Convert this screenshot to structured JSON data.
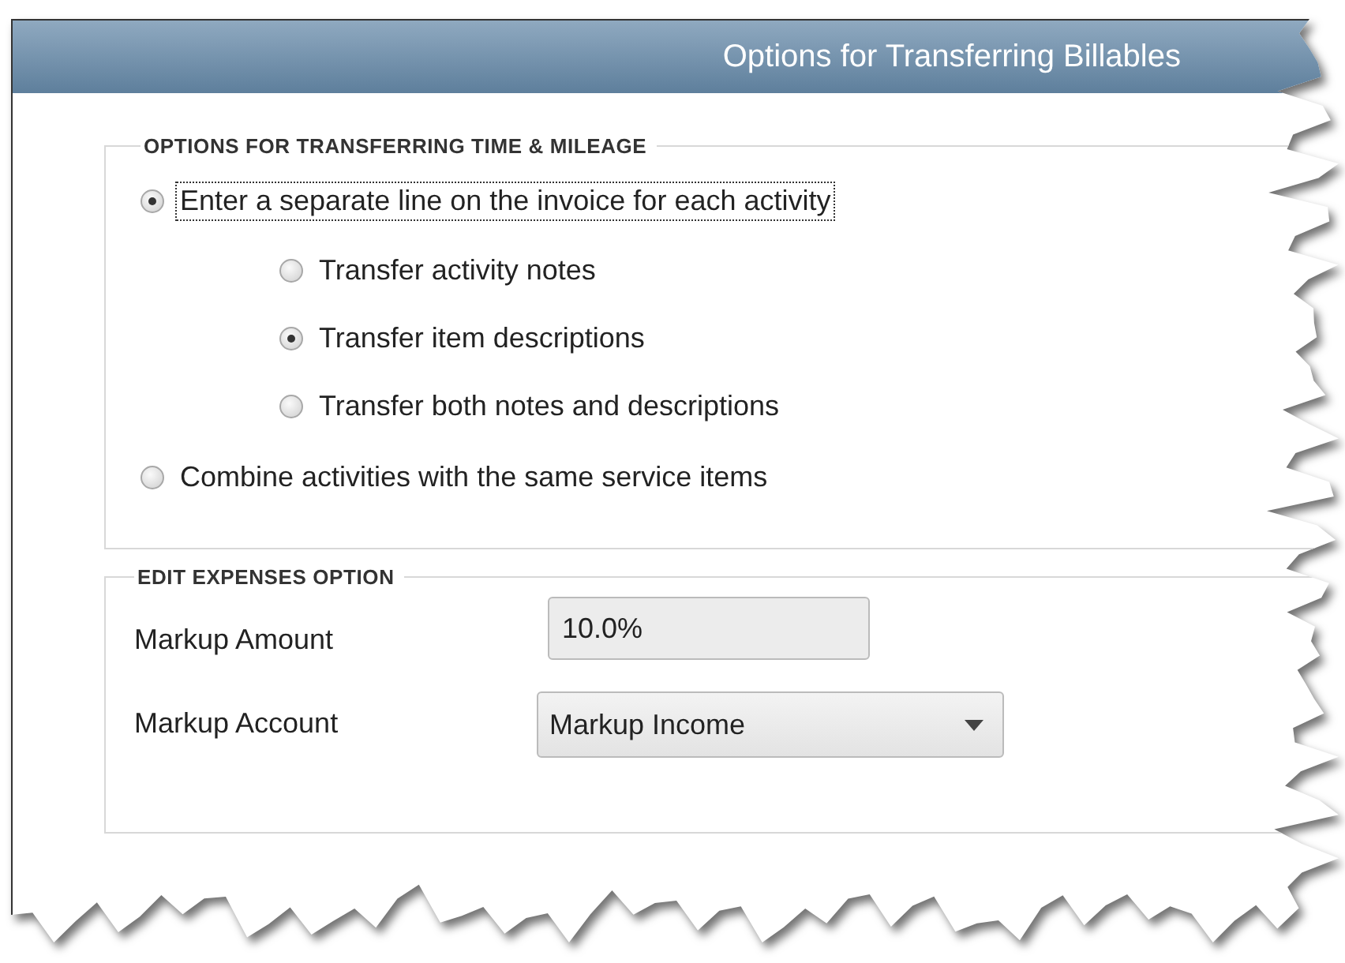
{
  "window": {
    "title": "Options for Transferring Billables"
  },
  "sections": [
    {
      "legend": "OPTIONS FOR TRANSFERRING TIME & MILEAGE",
      "kind": "radios",
      "options": [
        {
          "label": "Enter a separate line on the invoice for each activity",
          "selected": true,
          "focused": true,
          "children": [
            {
              "label": "Transfer activity notes",
              "selected": false
            },
            {
              "label": "Transfer item descriptions",
              "selected": true
            },
            {
              "label": "Transfer both notes and descriptions",
              "selected": false
            }
          ]
        },
        {
          "label": "Combine activities with the same service items",
          "selected": false,
          "focused": false
        }
      ]
    },
    {
      "legend": "EDIT EXPENSES OPTION",
      "kind": "fields",
      "fields": [
        {
          "label": "Markup Amount",
          "kind": "text",
          "value": "10.0%"
        },
        {
          "label": "Markup Account",
          "kind": "dropdown",
          "value": "Markup Income"
        }
      ]
    }
  ]
}
